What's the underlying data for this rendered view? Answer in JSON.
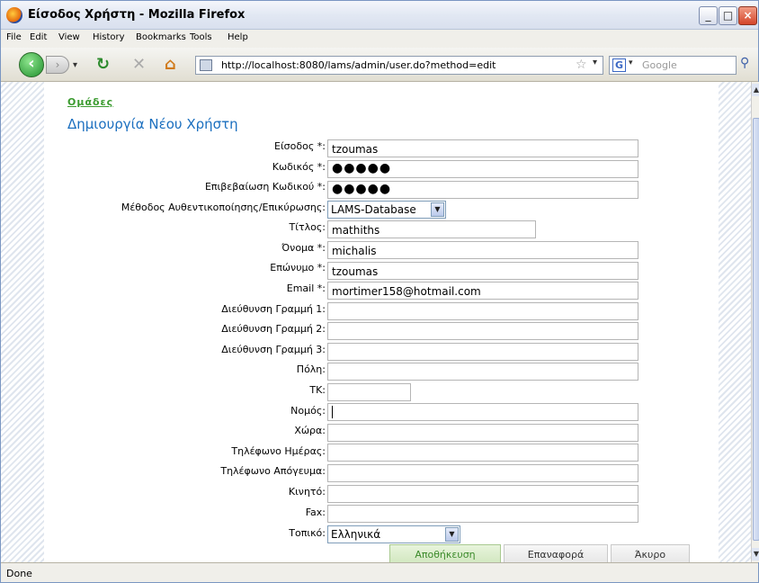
{
  "window": {
    "title": "Είσοδος Χρήστη - Mozilla Firefox"
  },
  "menu": [
    "File",
    "Edit",
    "View",
    "History",
    "Bookmarks",
    "Tools",
    "Help"
  ],
  "nav": {
    "url": "http://localhost:8080/lams/admin/user.do?method=edit",
    "search_engine": "G",
    "search_placeholder": "Google"
  },
  "page": {
    "groups_link": "Ομάδες",
    "title": "Δημιουργία Νέου Χρήστη",
    "fields": [
      {
        "label": "Είσοδος *:",
        "value": "tzoumas"
      },
      {
        "label": "Κωδικός *:",
        "value": "●●●●●"
      },
      {
        "label": "Επιβεβαίωση Κωδικού *:",
        "value": "●●●●●"
      },
      {
        "label": "Μέθοδος Αυθεντικοποίησης/Επικύρωσης:",
        "value": "LAMS-Database"
      },
      {
        "label": "Τίτλος:",
        "value": "mathiths"
      },
      {
        "label": "Όνομα *:",
        "value": "michalis"
      },
      {
        "label": "Επώνυμο *:",
        "value": "tzoumas"
      },
      {
        "label": "Email *:",
        "value": "mortimer158@hotmail.com"
      },
      {
        "label": "Διεύθυνση Γραμμή 1:",
        "value": ""
      },
      {
        "label": "Διεύθυνση Γραμμή 2:",
        "value": ""
      },
      {
        "label": "Διεύθυνση Γραμμή 3:",
        "value": ""
      },
      {
        "label": "Πόλη:",
        "value": ""
      },
      {
        "label": "ΤΚ:",
        "value": ""
      },
      {
        "label": "Νομός:",
        "value": ""
      },
      {
        "label": "Χώρα:",
        "value": ""
      },
      {
        "label": "Τηλέφωνο Ημέρας:",
        "value": ""
      },
      {
        "label": "Τηλέφωνο Απόγευμα:",
        "value": ""
      },
      {
        "label": "Κινητό:",
        "value": ""
      },
      {
        "label": "Fax:",
        "value": ""
      },
      {
        "label": "Τοπικό:",
        "value": "Ελληνικά"
      }
    ],
    "buttons": {
      "save": "Αποθήκευση",
      "reset": "Επαναφορά",
      "cancel": "Άκυρο"
    }
  },
  "status": "Done"
}
